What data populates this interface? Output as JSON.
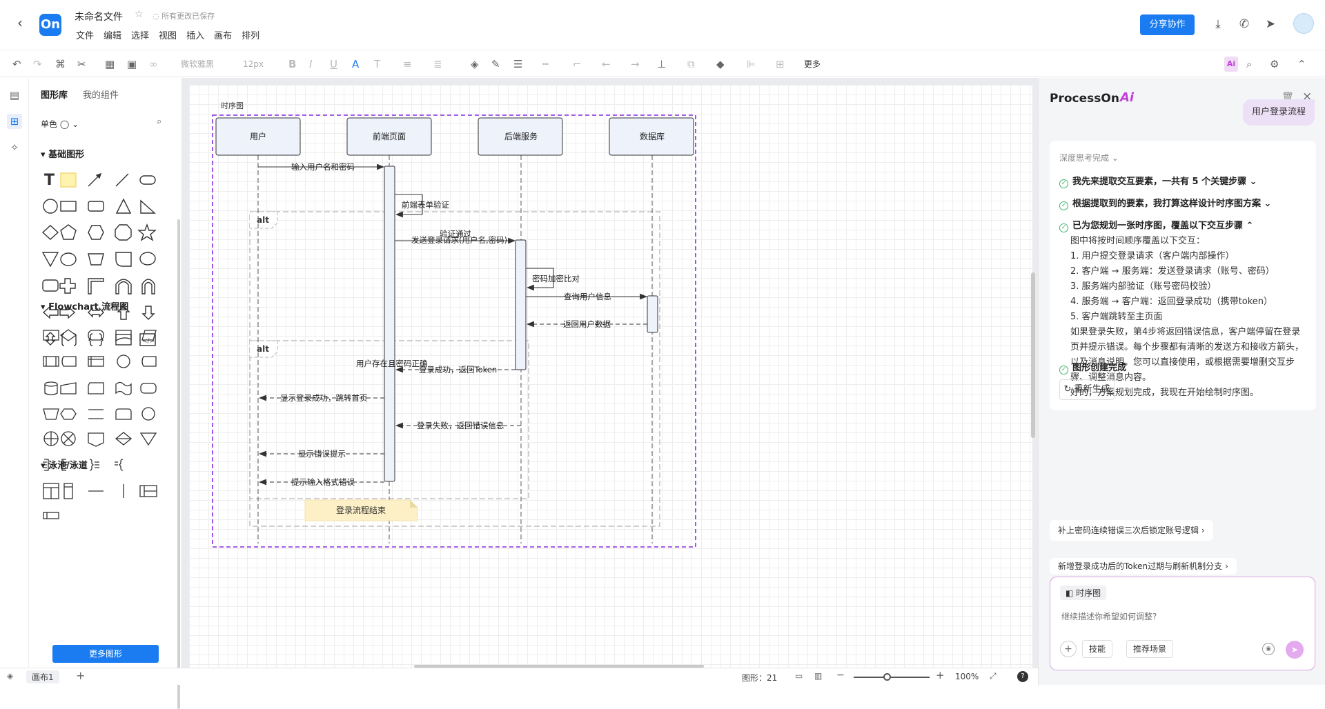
{
  "app": {
    "logo": "On",
    "doc_title": "未命名文件",
    "save_status": "所有更改已保存",
    "menu": [
      "文件",
      "编辑",
      "选择",
      "视图",
      "插入",
      "画布",
      "排列"
    ],
    "share_label": "分享协作"
  },
  "toolbar": {
    "font": "微软雅黑",
    "size": "12px",
    "more": "更多"
  },
  "left_panel": {
    "tabs": [
      "图形库",
      "我的组件"
    ],
    "color_mode": "单色",
    "sections": [
      "基础图形",
      "Flowchart 流程图",
      "泳池/泳道"
    ],
    "more_shapes": "更多图形"
  },
  "status": {
    "page_tab": "画布1",
    "shape_count": "图形：21",
    "zoom": "100%"
  },
  "diagram": {
    "frame_label": "时序图",
    "participants": [
      "用户",
      "前端页面",
      "后端服务",
      "数据库"
    ],
    "alt_label": "alt",
    "messages": [
      "输入用户名和密码",
      "前端表单验证",
      "验证通过",
      "发送登录请求(用户名,密码)",
      "密码加密比对",
      "查询用户信息",
      "返回用户数据",
      "用户存在且密码正确",
      "登录成功，返回Token",
      "显示登录成功，跳转首页",
      "登录失败，返回错误信息",
      "显示错误提示",
      "提示输入格式错误"
    ],
    "note": "登录流程结束"
  },
  "ai_panel": {
    "brand": "ProcessOn",
    "brand_ai": "Ai",
    "user_message": "用户登录流程",
    "thinking": "深度思考完成",
    "steps": [
      "我先来提取交互要素，一共有 5 个关键步骤",
      "根据提取到的要素，我打算这样设计时序图方案",
      "已为您规划一张时序图，覆盖以下交互步骤"
    ],
    "body_lines": [
      "图中将按时间顺序覆盖以下交互：",
      "1. 用户提交登录请求（客户端内部操作）",
      "2. 客户端 → 服务端：发送登录请求（账号、密码）",
      "3. 服务端内部验证（账号密码校验）",
      "4. 服务端 → 客户端：返回登录成功（携带token）",
      "5. 客户端跳转至主页面",
      "如果登录失败，第4步将返回错误信息，客户端停留在登录页并提示错误。每个步骤都有清晰的发送方和接收方箭头，以及消息说明。您可以直接使用，或根据需要增删交互步骤、调整消息内容。",
      "好的，方案规划完成，我现在开始绘制时序图。"
    ],
    "done": "图形创建完成",
    "regenerate": "重新生成",
    "suggestions": [
      "补上密码连续错误三次后锁定账号逻辑",
      "新增登录成功后的Token过期与刷新机制分支"
    ],
    "input_tag": "时序图",
    "input_placeholder": "继续描述你希望如何调整?",
    "chip_skill": "技能",
    "chip_scene": "推荐场景"
  }
}
